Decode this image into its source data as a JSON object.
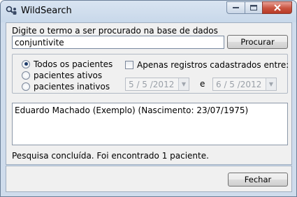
{
  "window": {
    "title": "WildSearch",
    "icon": "search-people-icon",
    "controls": {
      "minimize": "minimize-icon",
      "maximize": "maximize-icon",
      "close": "close-icon"
    }
  },
  "search": {
    "label": "Digite o termo a ser procurado na base de dados",
    "value": "conjuntivite",
    "button_label": "Procurar"
  },
  "filters": {
    "radios": [
      {
        "label": "Todos os pacientes",
        "checked": true
      },
      {
        "label": "pacientes ativos",
        "checked": false
      },
      {
        "label": "pacientes inativos",
        "checked": false
      }
    ],
    "date_range_checkbox": {
      "label": "Apenas registros cadastrados entre:",
      "checked": false
    },
    "date_start": "5 / 5 /2012",
    "date_conjunction": "e",
    "date_end": "6 / 5 /2012"
  },
  "results": {
    "items": [
      "Eduardo Machado (Exemplo) (Nascimento: 23/07/1975)"
    ]
  },
  "status_text": "Pesquisa concluída. Foi encontrado 1 paciente.",
  "footer": {
    "close_label": "Fechar"
  },
  "colors": {
    "frame": "#cfdcec",
    "close_button": "#c9533f",
    "panel": "#f0f0f0"
  }
}
